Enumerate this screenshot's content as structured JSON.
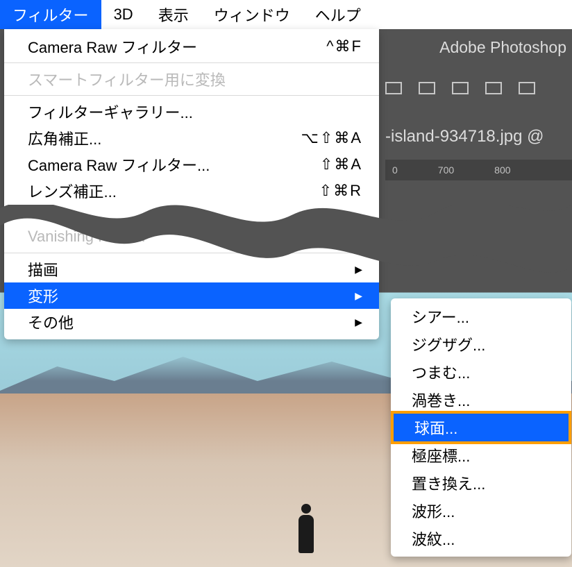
{
  "menubar": {
    "filter": "フィルター",
    "threeD": "3D",
    "view": "表示",
    "window": "ウィンドウ",
    "help": "ヘルプ"
  },
  "app": {
    "title": "Adobe Photoshop",
    "document_tab": "-island-934718.jpg @",
    "ruler": [
      "0",
      "700",
      "800"
    ]
  },
  "dropdown": {
    "camera_raw_recent": {
      "label": "Camera Raw フィルター",
      "shortcut": "^⌘F"
    },
    "smart_convert": {
      "label": "スマートフィルター用に変換"
    },
    "gallery": {
      "label": "フィルターギャラリー..."
    },
    "wide_angle": {
      "label": "広角補正...",
      "shortcut": "⌥⇧⌘A"
    },
    "camera_raw": {
      "label": "Camera Raw フィルター...",
      "shortcut": "⇧⌘A"
    },
    "lens_correction": {
      "label": "レンズ補正...",
      "shortcut": "⇧⌘R"
    },
    "vanishing_point": {
      "label": "Vanishing Point..."
    },
    "render": {
      "label": "描画"
    },
    "distort": {
      "label": "変形"
    },
    "other": {
      "label": "その他"
    }
  },
  "submenu": {
    "shear": "シアー...",
    "zigzag": "ジグザグ...",
    "pinch": "つまむ...",
    "twirl": "渦巻き...",
    "spherize": "球面...",
    "polar": "極座標...",
    "displace": "置き換え...",
    "wave": "波形...",
    "ripple": "波紋..."
  }
}
